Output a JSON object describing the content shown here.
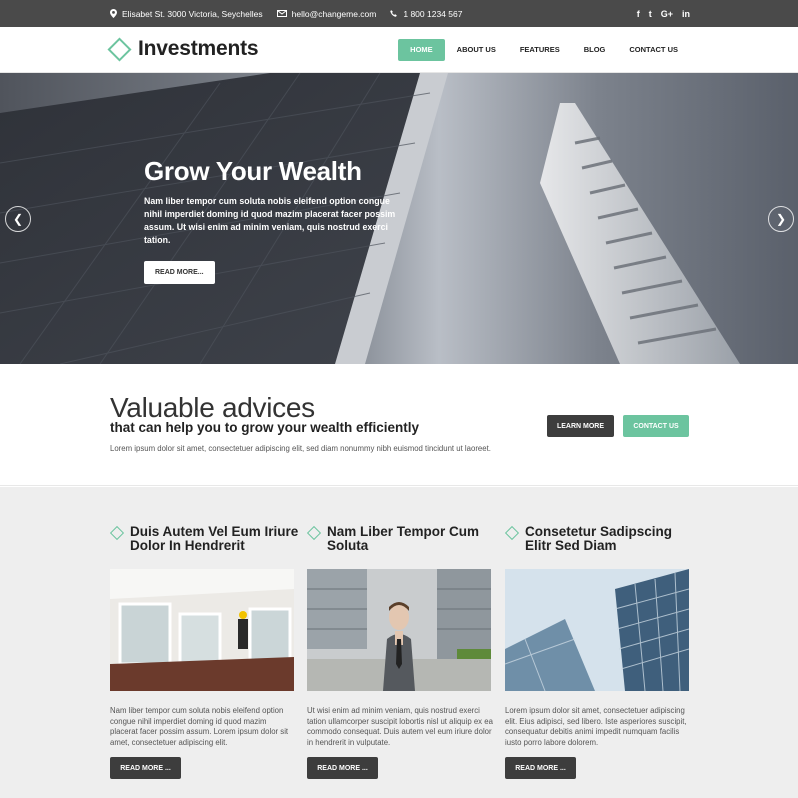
{
  "topbar": {
    "address": "Elisabet St. 3000 Victoria, Seychelles",
    "email": "hello@changeme.com",
    "phone": "1 800 1234 567",
    "social": [
      "f",
      "t",
      "G+",
      "in"
    ]
  },
  "header": {
    "logo_text": "Investments",
    "nav": [
      "HOME",
      "ABOUT US",
      "FEATURES",
      "BLOG",
      "CONTACT US"
    ]
  },
  "hero": {
    "title": "Grow Your Wealth",
    "text": "Nam liber tempor cum soluta nobis eleifend option congue nihil imperdiet doming id quod mazim placerat facer possim assum. Ut wisi enim ad minim veniam, quis nostrud exerci tation.",
    "button": "READ MORE..."
  },
  "advice": {
    "title": "Valuable advices",
    "subtitle": "that can help you to grow your wealth efficiently",
    "text": "Lorem ipsum dolor sit amet, consectetuer adipiscing elit, sed diam nonummy nibh euismod tincidunt ut laoreet.",
    "learn_more": "LEARN MORE",
    "contact_us": "CONTACT US"
  },
  "cards": [
    {
      "title": "Duis Autem Vel Eum Iriure Dolor In Hendrerit",
      "text": "Nam liber tempor cum soluta nobis eleifend option congue nihil imperdiet doming id quod mazim placerat facer possim assum. Lorem ipsum dolor sit amet, consectetuer adipiscing elit.",
      "button": "READ MORE ..."
    },
    {
      "title": "Nam Liber Tempor Cum Soluta",
      "text": "Ut wisi enim ad minim veniam, quis nostrud exerci tation ullamcorper suscipit lobortis nisl ut aliquip ex ea commodo consequat. Duis autem vel eum iriure dolor in hendrerit in vulputate.",
      "button": "READ MORE ..."
    },
    {
      "title": "Consetetur Sadipscing Elitr Sed Diam",
      "text": "Lorem ipsum dolor sit amet, consectetuer adipiscing elit. Eius adipisci, sed libero. Iste asperiores suscipit, consequatur debitis animi impedit numquam facilis iusto porro labore dolorem.",
      "button": "READ MORE ..."
    }
  ],
  "colors": {
    "accent": "#6cc49f",
    "dark": "#3d3d3d",
    "topbar": "#4a4a4a"
  }
}
